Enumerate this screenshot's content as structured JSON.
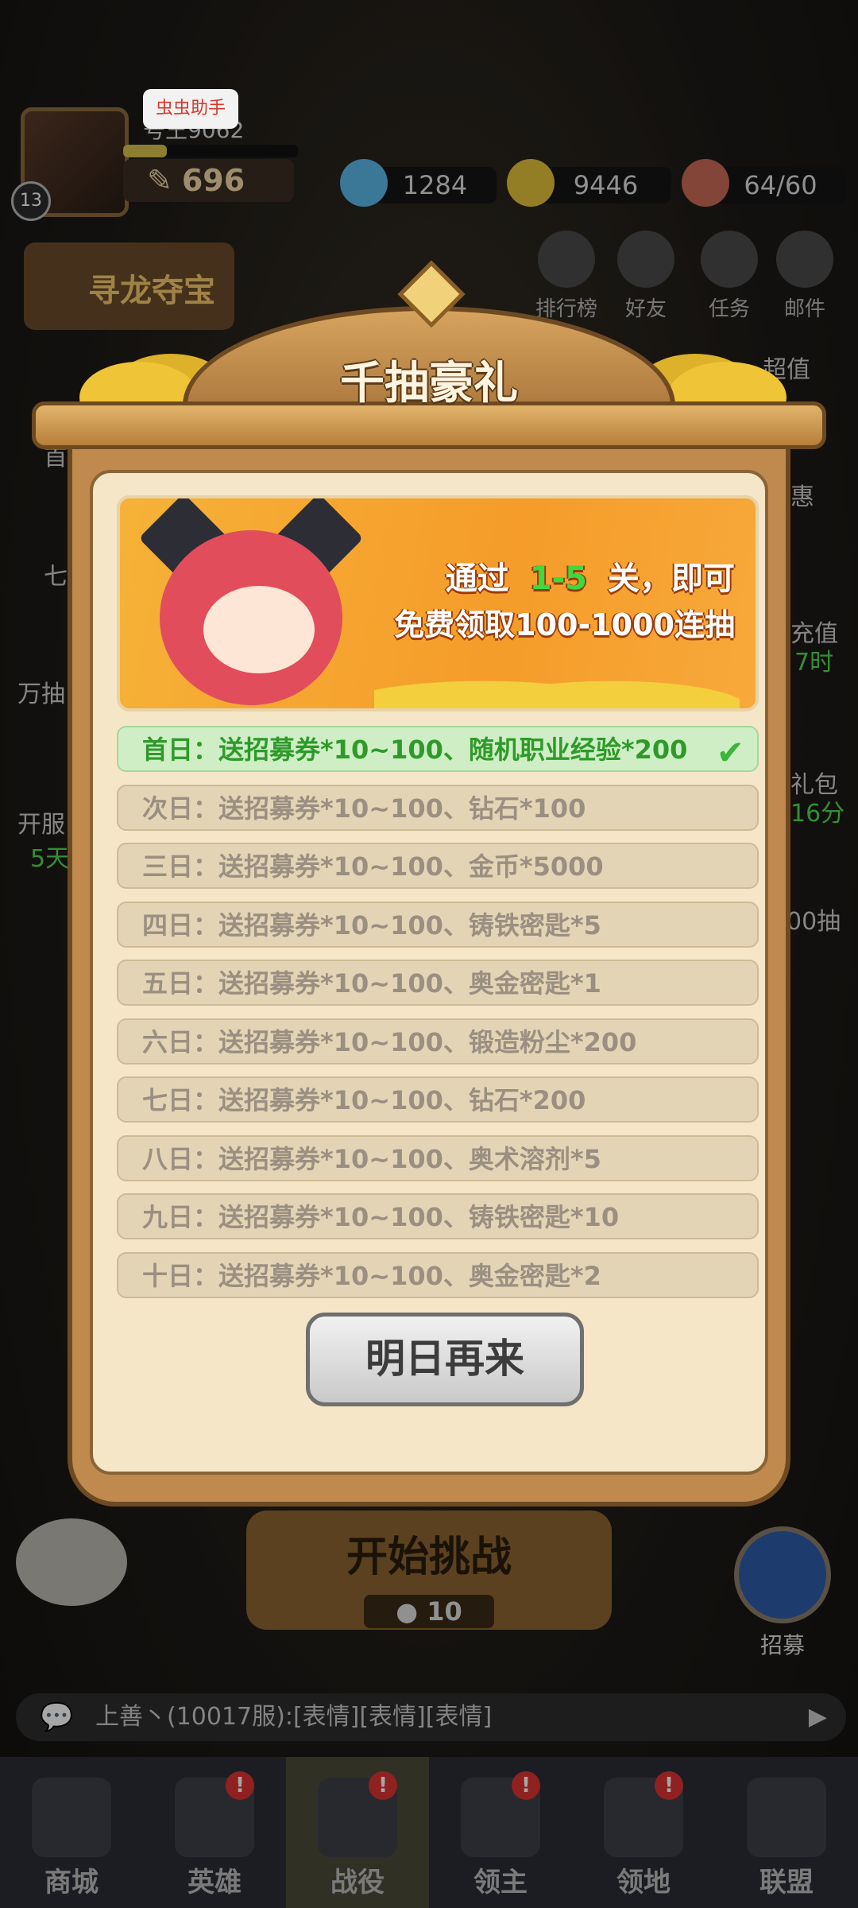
{
  "hud": {
    "player_name": "号王9062",
    "level": "13",
    "power": "696",
    "diamonds": "1284",
    "gold": "9446",
    "stamina": "64/60",
    "top_buttons": [
      "排行榜",
      "好友",
      "任务",
      "邮件"
    ],
    "event_banner": "寻龙夺宝",
    "right_labels": [
      "超值",
      "惠",
      "充值",
      "7时",
      "礼包",
      "16分",
      "00抽"
    ],
    "left_labels": [
      "首",
      "七",
      "万抽",
      "开服",
      "5天"
    ]
  },
  "helper": {
    "label": "虫虫助手"
  },
  "popup": {
    "title": "千抽豪礼",
    "banner": {
      "line1_prefix": "通过",
      "line1_highlight": "1-5",
      "line1_suffix": "关，即可",
      "line2": "免费领取100-1000连抽"
    },
    "days": [
      {
        "label": "首日：送招募券*10~100、随机职业经验*200",
        "claimed": true
      },
      {
        "label": "次日：送招募券*10~100、钻石*100",
        "claimed": false
      },
      {
        "label": "三日：送招募券*10~100、金币*5000",
        "claimed": false
      },
      {
        "label": "四日：送招募券*10~100、铸铁密匙*5",
        "claimed": false
      },
      {
        "label": "五日：送招募券*10~100、奥金密匙*1",
        "claimed": false
      },
      {
        "label": "六日：送招募券*10~100、锻造粉尘*200",
        "claimed": false
      },
      {
        "label": "七日：送招募券*10~100、钻石*200",
        "claimed": false
      },
      {
        "label": "八日：送招募券*10~100、奥术溶剂*5",
        "claimed": false
      },
      {
        "label": "九日：送招募券*10~100、铸铁密匙*10",
        "claimed": false
      },
      {
        "label": "十日：送招募券*10~100、奥金密匙*2",
        "claimed": false
      }
    ],
    "button_label": "明日再来"
  },
  "stage": {
    "start_label": "开始挑战",
    "cost": "10"
  },
  "recruit_label": "招募",
  "chat": {
    "text": "上善丶(10017服):[表情][表情][表情]"
  },
  "tabs": [
    {
      "label": "商城",
      "badge": ""
    },
    {
      "label": "英雄",
      "badge": "!"
    },
    {
      "label": "战役",
      "badge": "!"
    },
    {
      "label": "领主",
      "badge": "!"
    },
    {
      "label": "领地",
      "badge": "!"
    },
    {
      "label": "联盟",
      "badge": ""
    }
  ],
  "colors": {
    "accent_green": "#2e9a2a",
    "frame_brown": "#6e4a22",
    "banner_orange": "#f59c2a"
  }
}
